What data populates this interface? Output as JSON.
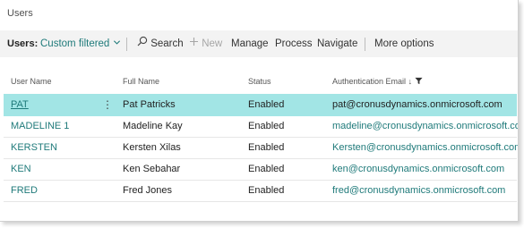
{
  "page": {
    "title": "Users"
  },
  "toolbar": {
    "filter_label": "Users:",
    "filter_value": "Custom filtered",
    "search_label": "Search",
    "new_label": "New",
    "manage_label": "Manage",
    "process_label": "Process",
    "navigate_label": "Navigate",
    "more_options_label": "More options",
    "icons": [
      "chevron-down-icon",
      "search-icon",
      "plus-icon",
      "filter-icon"
    ]
  },
  "table": {
    "columns": [
      "User Name",
      "Full Name",
      "Status",
      "Authentication Email"
    ],
    "sort_indicator": "↓",
    "rows": [
      {
        "user_name": "PAT",
        "full_name": "Pat Patricks",
        "status": "Enabled",
        "email": "pat@cronusdynamics.onmicrosoft.com",
        "selected": true
      },
      {
        "user_name": "MADELINE 1",
        "full_name": "Madeline Kay",
        "status": "Enabled",
        "email": "madeline@cronusdynamics.onmicrosoft.com",
        "selected": false
      },
      {
        "user_name": "KERSTEN",
        "full_name": "Kersten Xilas",
        "status": "Enabled",
        "email": "Kersten@cronusdynamics.onmicrosoft.com",
        "selected": false
      },
      {
        "user_name": "KEN",
        "full_name": "Ken Sebahar",
        "status": "Enabled",
        "email": "ken@cronusdynamics.onmicrosoft.com",
        "selected": false
      },
      {
        "user_name": "FRED",
        "full_name": "Fred Jones",
        "status": "Enabled",
        "email": "fred@cronusdynamics.onmicrosoft.com",
        "selected": false
      }
    ]
  },
  "colors": {
    "accent": "#1f7a7a",
    "selected_row": "#a2e5e5",
    "toolbar_bg": "#f3f3f3"
  }
}
